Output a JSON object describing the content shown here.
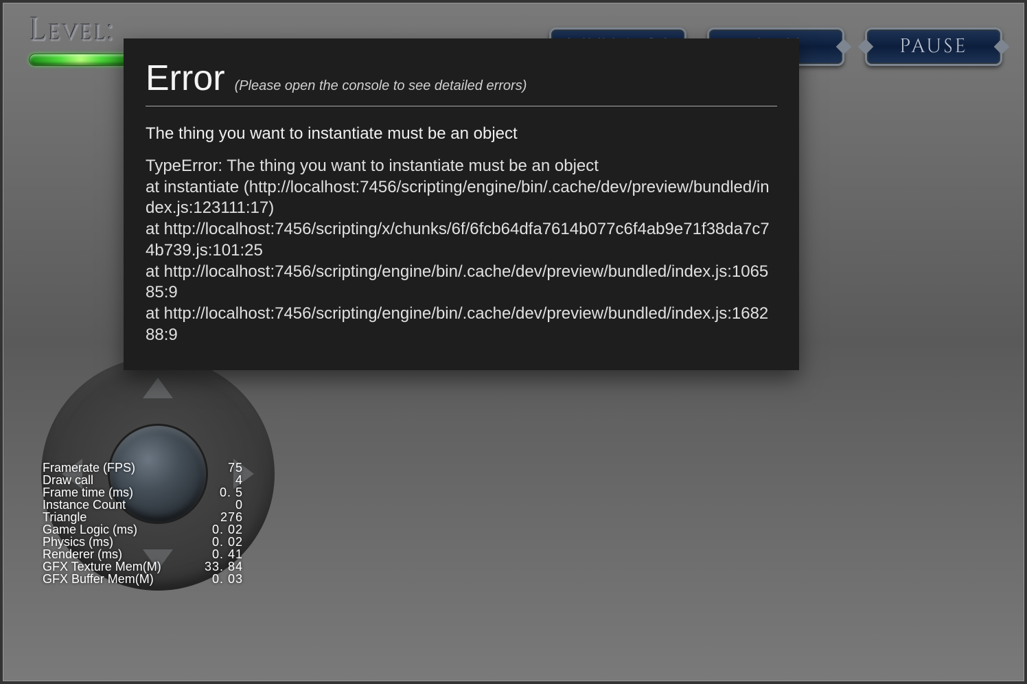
{
  "hud": {
    "level_label": "Level:",
    "buttons": {
      "settings": "SETTINGS",
      "exit": "EXIT",
      "pause": "PAUSE"
    }
  },
  "error": {
    "title": "Error",
    "subtitle": "(Please open the console to see detailed errors)",
    "message": "The thing you want to instantiate must be an object",
    "stack": "TypeError: The thing you want to instantiate must be an object\nat instantiate (http://localhost:7456/scripting/engine/bin/.cache/dev/preview/bundled/index.js:123111:17)\nat http://localhost:7456/scripting/x/chunks/6f/6fcb64dfa7614b077c6f4ab9e71f38da7c74b739.js:101:25\nat http://localhost:7456/scripting/engine/bin/.cache/dev/preview/bundled/index.js:106585:9\nat http://localhost:7456/scripting/engine/bin/.cache/dev/preview/bundled/index.js:168288:9"
  },
  "stats": {
    "rows": [
      {
        "label": "Framerate (FPS)",
        "value": "75"
      },
      {
        "label": "Draw call",
        "value": "4"
      },
      {
        "label": "Frame time (ms)",
        "value": "0. 5"
      },
      {
        "label": "Instance Count",
        "value": "0"
      },
      {
        "label": "Triangle",
        "value": "276"
      },
      {
        "label": "Game Logic (ms)",
        "value": "0. 02"
      },
      {
        "label": "Physics (ms)",
        "value": "0. 02"
      },
      {
        "label": "Renderer (ms)",
        "value": "0. 41"
      },
      {
        "label": "GFX Texture Mem(M)",
        "value": "33. 84"
      },
      {
        "label": "GFX Buffer Mem(M)",
        "value": "0. 03"
      }
    ]
  }
}
